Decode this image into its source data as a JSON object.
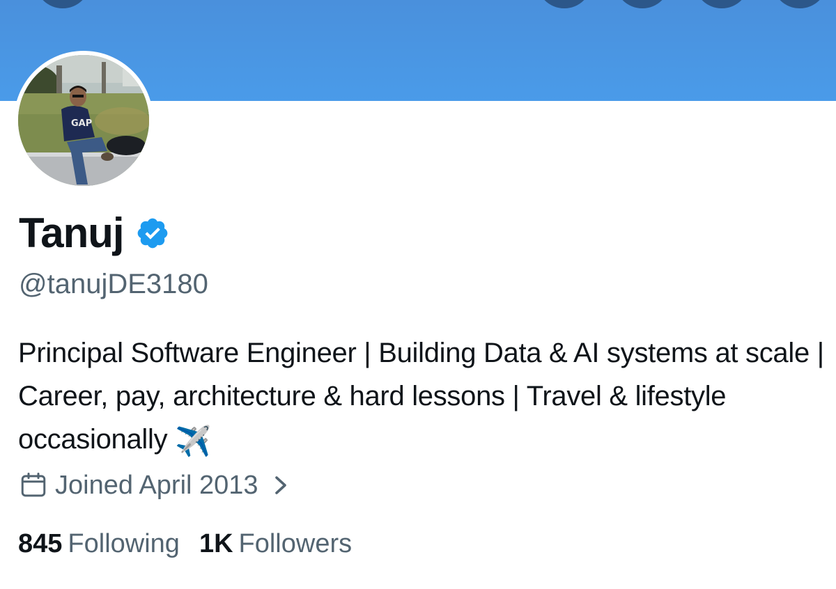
{
  "profile": {
    "name": "Tanuj",
    "handle": "@tanujDE3180",
    "verified_icon": "verified-badge-icon",
    "bio": "Principal Software Engineer | Building Data & AI systems at scale | Career, pay, architecture & hard lessons | Travel & lifestyle occasionally",
    "bio_emoji": "✈️",
    "joined": "Joined April 2013",
    "following_count": "845",
    "following_label": "Following",
    "followers_count": "1K",
    "followers_label": "Followers"
  },
  "icons": {
    "calendar": "calendar-icon",
    "chevron": "chevron-right-icon"
  },
  "colors": {
    "banner": "#4a9be9",
    "verified": "#1d9bf0",
    "text_primary": "#0f1419",
    "text_secondary": "#536471"
  }
}
